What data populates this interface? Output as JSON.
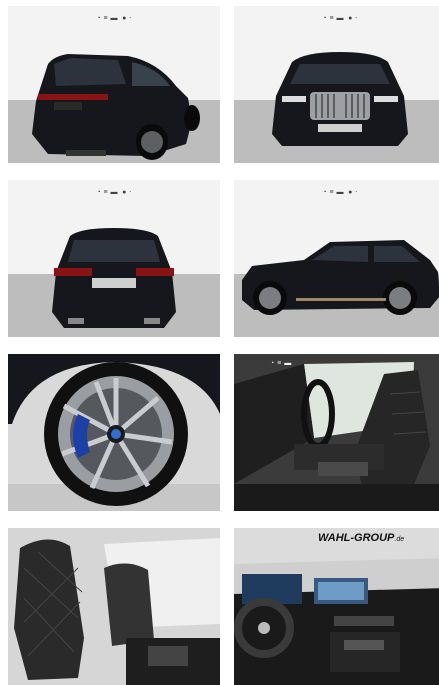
{
  "gallery": {
    "images": [
      {
        "label": "rear-three-quarter-view"
      },
      {
        "label": "front-view"
      },
      {
        "label": "rear-view"
      },
      {
        "label": "side-view"
      },
      {
        "label": "wheel-detail"
      },
      {
        "label": "driver-seat-interior"
      },
      {
        "label": "front-seats-interior"
      },
      {
        "label": "dashboard-cockpit"
      }
    ]
  },
  "dealer_watermark": {
    "text": "WAHL-GROUP",
    "suffix": ".de"
  },
  "colors": {
    "car_body": "#15171c",
    "showroom_wall": "#f3f3f3",
    "showroom_floor": "#bdbdbd",
    "leather": "#2a2a2a"
  }
}
